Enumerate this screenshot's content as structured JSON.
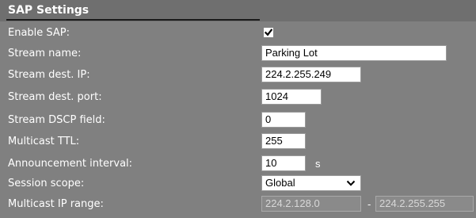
{
  "section": {
    "title": "SAP Settings"
  },
  "rows": {
    "enable_sap": {
      "label": "Enable SAP:",
      "checked": true
    },
    "stream_name": {
      "label": "Stream name:",
      "value": "Parking Lot"
    },
    "stream_dest_ip": {
      "label": "Stream dest. IP:",
      "value": "224.2.255.249"
    },
    "stream_dest_port": {
      "label": "Stream dest. port:",
      "value": "1024"
    },
    "stream_dscp": {
      "label": "Stream DSCP field:",
      "value": "0"
    },
    "multicast_ttl": {
      "label": "Multicast TTL:",
      "value": "255"
    },
    "announcement_interval": {
      "label": "Announcement interval:",
      "value": "10",
      "unit": "s"
    },
    "session_scope": {
      "label": "Session scope:",
      "selected": "Global"
    },
    "multicast_ip_range": {
      "label": "Multicast IP range:",
      "start": "224.2.128.0",
      "separator": "-",
      "end": "224.2.255.255"
    }
  },
  "icons": {
    "checkbox": "checkmark-icon",
    "select": "chevron-down-icon"
  },
  "colors": {
    "panel_background": "#808080",
    "header_background": "#6f6f6f",
    "label_text": "#ffffff",
    "disabled_field": "#8a8a8a"
  }
}
